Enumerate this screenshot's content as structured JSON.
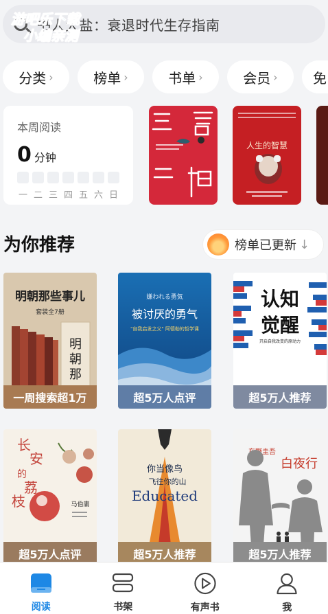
{
  "watermark": {
    "line1": "游吧乐下载",
    "line2": "小编亲测"
  },
  "search": {
    "text": "大家都在搜：衰退时代生存指南",
    "visible_text": "书人大盐：衰退时代生存指南"
  },
  "chips": [
    {
      "label": "分类"
    },
    {
      "label": "榜单"
    },
    {
      "label": "书单"
    },
    {
      "label": "会员"
    },
    {
      "label": "免"
    }
  ],
  "weekly": {
    "title": "本周阅读",
    "minutes": "0",
    "unit": "分钟",
    "days": [
      "一",
      "二",
      "三",
      "四",
      "五",
      "六",
      "日"
    ]
  },
  "top_covers": [
    {
      "title": "三言二拍",
      "color": "#d4283a"
    },
    {
      "title": "人生的智慧",
      "color": "#c51f23"
    }
  ],
  "recommend": {
    "title": "为你推荐",
    "rank_label": "榜单已更新",
    "rank_arrow": "↓"
  },
  "books": [
    {
      "cover_title": "明朝那些事儿",
      "cover_sub": "套装全7册",
      "caption": "一周搜索超1万",
      "cap_color": "#a87a52"
    },
    {
      "cover_title": "被讨厌的勇气",
      "cover_sub": "嫌われる勇気",
      "caption": "超5万人点评",
      "cap_color": "#5f7da6"
    },
    {
      "cover_title": "认知觉醒",
      "cover_sub": "开启自我改变的原动力",
      "caption": "超5万人推荐",
      "cap_color": "#7f8aa0"
    },
    {
      "cover_title": "长安的荔枝",
      "cover_sub": "马伯庸",
      "caption": "超5万人点评",
      "cap_color": "#9a7b5f"
    },
    {
      "cover_title": "你当像鸟飞往你的山",
      "cover_sub": "Educated",
      "caption": "超5万人推荐",
      "cap_color": "#a7875e"
    },
    {
      "cover_title": "白夜行",
      "cover_sub": "东野圭吾",
      "caption": "超5万人推荐",
      "cap_color": "#8d8d8d"
    }
  ],
  "nav": [
    {
      "label": "阅读",
      "icon": "book-icon",
      "active": true
    },
    {
      "label": "书架",
      "icon": "shelf-icon",
      "active": false
    },
    {
      "label": "有声书",
      "icon": "play-icon",
      "active": false
    },
    {
      "label": "我",
      "icon": "person-icon",
      "active": false
    }
  ],
  "colors": {
    "accent": "#1e88e5",
    "background": "#f3f4f6"
  }
}
